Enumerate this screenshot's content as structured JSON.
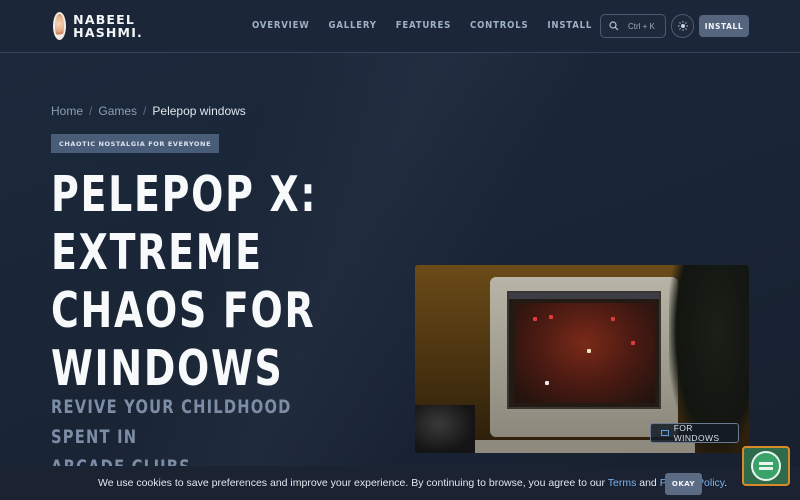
{
  "brand": {
    "line1": "NABEEL",
    "line2": "HASHMI."
  },
  "nav": {
    "items": [
      "OVERVIEW",
      "GALLERY",
      "FEATURES",
      "CONTROLS",
      "INSTALL"
    ]
  },
  "header": {
    "search_shortcut": "Ctrl + K",
    "install_label": "INSTALL",
    "icons": {
      "search": "search-icon",
      "theme": "sun-icon"
    }
  },
  "breadcrumb": {
    "home": "Home",
    "section": "Games",
    "current": "Pelepop windows"
  },
  "hero": {
    "tag": "CHAOTIC NOSTALGIA FOR EVERYONE",
    "title_lines": [
      "PELEPOP X:",
      "EXTREME",
      "CHAOS FOR",
      "WINDOWS"
    ],
    "subtitle_lines": [
      "REVIVE YOUR CHILDHOOD SPENT IN",
      "ARCADE CLUBS."
    ],
    "platform_badge": "FOR WINDOWS"
  },
  "cookie": {
    "text_before": "We use cookies to save preferences and improve your experience. By continuing to browse, you agree to our ",
    "terms": "Terms",
    "and": " and ",
    "privacy": "Privacy Policy",
    "end": ".",
    "okay_label": "OKAY"
  },
  "colors": {
    "accent_link": "#7db4ea",
    "button_bg": "#55657d",
    "chat_border": "#d88a2a"
  }
}
